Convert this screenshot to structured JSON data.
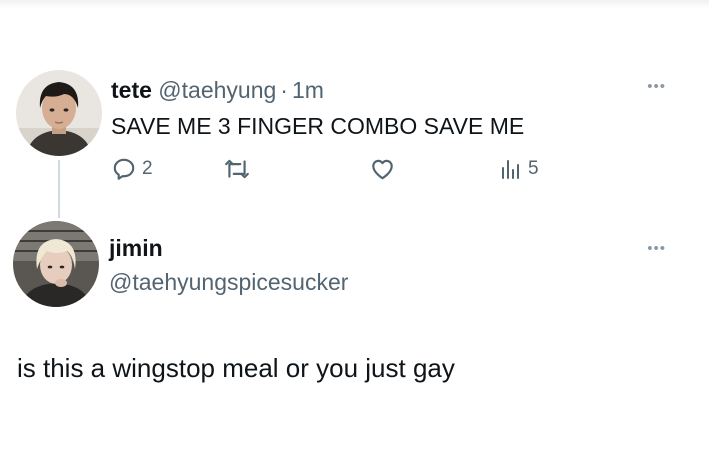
{
  "tweets": [
    {
      "name": "tete",
      "handle": "@taehyung",
      "separator": "·",
      "time": "1m",
      "text": "SAVE ME 3 FINGER COMBO SAVE ME",
      "more_icon": "more-horizontal-icon",
      "actions": {
        "reply": {
          "icon": "reply-icon",
          "count": "2"
        },
        "retweet": {
          "icon": "retweet-icon",
          "count": ""
        },
        "like": {
          "icon": "heart-icon",
          "count": ""
        },
        "views": {
          "icon": "views-chart-icon",
          "count": "5"
        }
      }
    },
    {
      "name": "jimin",
      "handle": "@taehyungspicesucker",
      "text": "is this a wingstop meal or you just gay",
      "more_icon": "more-horizontal-icon"
    }
  ],
  "colors": {
    "text_primary": "#0f1419",
    "text_secondary": "#536471",
    "thread_line": "#cfd9de",
    "background": "#ffffff"
  }
}
